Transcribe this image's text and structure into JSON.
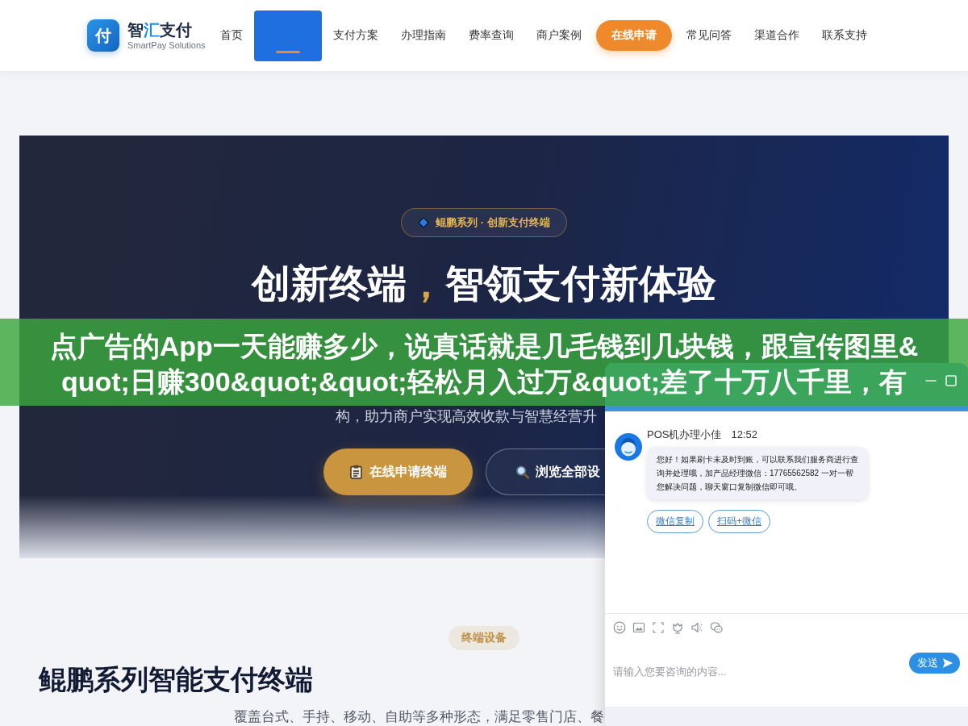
{
  "header": {
    "brand": {
      "mark": "付",
      "name_parts": [
        {
          "text": "智",
          "accent": false
        },
        {
          "text": "汇",
          "accent": true
        },
        {
          "text": "支付",
          "accent": false
        }
      ],
      "tagline": "SmartPay Solutions"
    },
    "nav": [
      {
        "label": "首页",
        "kind": "link",
        "selected": false
      },
      {
        "kind": "link",
        "selected": true
      },
      {
        "label": "支付方案",
        "kind": "link",
        "selected": false
      },
      {
        "label": "办理指南",
        "kind": "link",
        "selected": false
      },
      {
        "label": "费率查询",
        "kind": "link",
        "selected": false
      },
      {
        "label": "商户案例",
        "kind": "link",
        "selected": false
      },
      {
        "label": "在线申请",
        "kind": "cta",
        "selected": false
      },
      {
        "label": "常见问答",
        "kind": "link",
        "selected": false
      },
      {
        "label": "渠道合作",
        "kind": "link",
        "selected": false
      },
      {
        "label": "联系支持",
        "kind": "link",
        "selected": false
      }
    ]
  },
  "hero": {
    "badge": "鲲鹏系列 · 创新支付终端",
    "title_parts": [
      {
        "text": "创新终端",
        "accent": false
      },
      {
        "text": "，",
        "accent": true
      },
      {
        "text": "智领支付新体验",
        "accent": false
      }
    ],
    "text": "构，助力商户实现高效收款与智慧经营升",
    "buttons": [
      {
        "label": "在线申请终端",
        "kind": "primary"
      },
      {
        "label": "浏览全部设",
        "kind": "outline"
      }
    ]
  },
  "banner": {
    "text": "点广告的App一天能赚多少，说真话就是几毛钱到几块钱，跟宣传图里&quot;日赚300&quot;&quot;轻松月入过万&quot;差了十万八千里，有"
  },
  "section": {
    "tag": "终端设备",
    "title": "鲲鹏系列智能支付终端",
    "subtitle": "覆盖台式、手持、移动、自助等多种形态，满足零售门店、餐"
  },
  "chat": {
    "messages": [
      {
        "sender": "POS机办理小佳",
        "time": "12:52",
        "text": "您好！如果刷卡未及时到账，可以联系我们服务商进行查询并处理哦，加产品经理微信：17765562582 一对一帮您解决问题，聊天窗口复制微信即可哦。",
        "actions": [
          "微信复制",
          "扫码+微信"
        ]
      }
    ],
    "composer": {
      "placeholder": "请输入您要咨询的内容...",
      "send_label": "发送"
    }
  }
}
